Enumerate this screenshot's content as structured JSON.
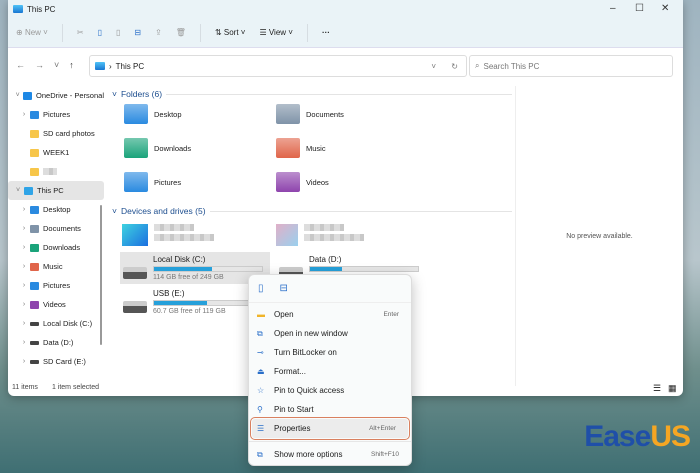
{
  "window": {
    "title": "This PC"
  },
  "toolbar": {
    "new": "New",
    "sort": "Sort",
    "view": "View",
    "more": "···"
  },
  "address": {
    "path": "This PC",
    "search_placeholder": "Search This PC"
  },
  "sidebar": {
    "items": [
      {
        "label": "OneDrive - Personal",
        "icon": "cloud-icon",
        "color": "#1e88e5",
        "expanded": true,
        "level": 0
      },
      {
        "label": "Pictures",
        "icon": "pictures-icon",
        "color": "#2a8ae0",
        "level": 1,
        "chev": true
      },
      {
        "label": "SD card photos",
        "icon": "folder-icon",
        "color": "#f7c64a",
        "level": 1
      },
      {
        "label": "WEEK1",
        "icon": "folder-icon",
        "color": "#f7c64a",
        "level": 1
      },
      {
        "label": "",
        "icon": "folder-icon",
        "color": "#f7c64a",
        "level": 1
      },
      {
        "label": "This PC",
        "icon": "pc-icon",
        "color": "#2fa4e7",
        "expanded": true,
        "level": 0,
        "selected": true
      },
      {
        "label": "Desktop",
        "icon": "desktop-icon",
        "color": "#2a8ae0",
        "level": 1,
        "chev": true
      },
      {
        "label": "Documents",
        "icon": "documents-icon",
        "color": "#7f93a8",
        "level": 1,
        "chev": true
      },
      {
        "label": "Downloads",
        "icon": "downloads-icon",
        "color": "#1aa37a",
        "level": 1,
        "chev": true
      },
      {
        "label": "Music",
        "icon": "music-icon",
        "color": "#e0654a",
        "level": 1,
        "chev": true
      },
      {
        "label": "Pictures",
        "icon": "pictures-icon",
        "color": "#2a8ae0",
        "level": 1,
        "chev": true
      },
      {
        "label": "Videos",
        "icon": "videos-icon",
        "color": "#8e44ad",
        "level": 1,
        "chev": true
      },
      {
        "label": "Local Disk (C:)",
        "icon": "drive-icon",
        "color": "#444",
        "level": 1,
        "chev": true
      },
      {
        "label": "Data (D:)",
        "icon": "drive-icon",
        "color": "#444",
        "level": 1,
        "chev": true
      },
      {
        "label": "SD Card (E:)",
        "icon": "drive-icon",
        "color": "#444",
        "level": 1,
        "chev": true
      }
    ]
  },
  "folders": {
    "header": "Folders (6)",
    "items": [
      {
        "label": "Desktop",
        "color": "#2a8ae0"
      },
      {
        "label": "Documents",
        "color": "#7f93a8"
      },
      {
        "label": "Downloads",
        "color": "#1aa37a"
      },
      {
        "label": "Music",
        "color": "#e0654a"
      },
      {
        "label": "Pictures",
        "color": "#2a8ae0"
      },
      {
        "label": "Videos",
        "color": "#8e44ad"
      }
    ]
  },
  "drives": {
    "header": "Devices and drives (5)",
    "items": [
      {
        "label": "Local Disk (C:)",
        "free": "114 GB free of 249 GB",
        "used_fraction": 0.54,
        "selected": true
      },
      {
        "label": "Data (D:)",
        "free": "",
        "used_fraction": 0.3
      },
      {
        "label": "USB (E:)",
        "free": "60.7 GB free of 119 GB",
        "used_fraction": 0.49
      }
    ]
  },
  "preview": {
    "text": "No preview available."
  },
  "status": {
    "count": "11 items",
    "selected": "1 item selected"
  },
  "context_menu": {
    "items": [
      {
        "label": "Open",
        "shortcut": "Enter",
        "icon": "folder-open-icon"
      },
      {
        "label": "Open in new window",
        "shortcut": "",
        "icon": "new-window-icon"
      },
      {
        "label": "Turn BitLocker on",
        "shortcut": "",
        "icon": "bitlocker-key-icon"
      },
      {
        "label": "Format...",
        "shortcut": "",
        "icon": "format-icon"
      },
      {
        "label": "Pin to Quick access",
        "shortcut": "",
        "icon": "star-icon"
      },
      {
        "label": "Pin to Start",
        "shortcut": "",
        "icon": "pin-icon"
      },
      {
        "label": "Properties",
        "shortcut": "Alt+Enter",
        "icon": "properties-icon",
        "highlighted": true
      },
      {
        "label": "Show more options",
        "shortcut": "Shift+F10",
        "icon": "more-options-icon"
      }
    ]
  },
  "watermark": {
    "text_a": "Ease",
    "text_b": "US"
  },
  "colors": {
    "accent": "#26a0da",
    "highlight_outline": "#d9805f"
  }
}
